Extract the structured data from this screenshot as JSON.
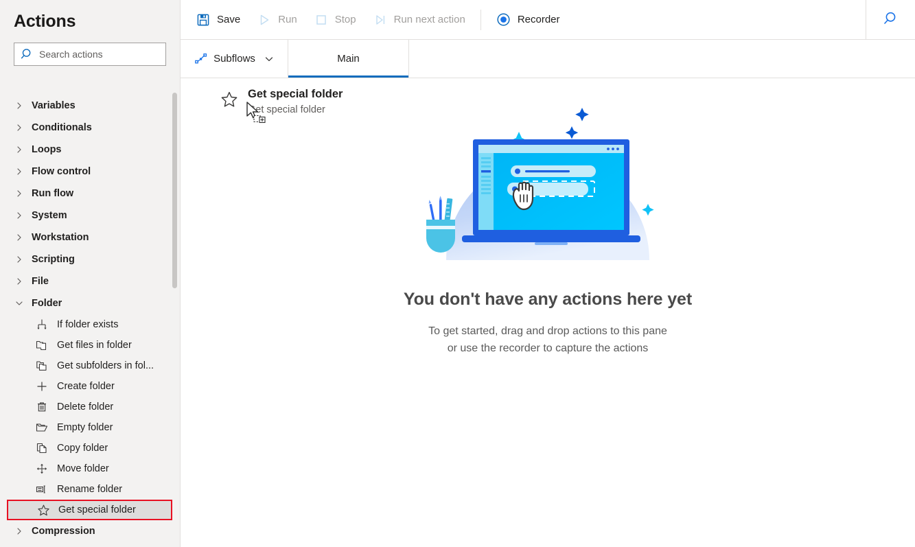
{
  "sidebar": {
    "title": "Actions",
    "search": {
      "placeholder": "Search actions",
      "value": "",
      "icon": "search-icon"
    },
    "groups": [
      {
        "label": "Variables",
        "expanded": false,
        "icon": "chevron-right-icon"
      },
      {
        "label": "Conditionals",
        "expanded": false,
        "icon": "chevron-right-icon"
      },
      {
        "label": "Loops",
        "expanded": false,
        "icon": "chevron-right-icon"
      },
      {
        "label": "Flow control",
        "expanded": false,
        "icon": "chevron-right-icon"
      },
      {
        "label": "Run flow",
        "expanded": false,
        "icon": "chevron-right-icon"
      },
      {
        "label": "System",
        "expanded": false,
        "icon": "chevron-right-icon"
      },
      {
        "label": "Workstation",
        "expanded": false,
        "icon": "chevron-right-icon"
      },
      {
        "label": "Scripting",
        "expanded": false,
        "icon": "chevron-right-icon"
      },
      {
        "label": "File",
        "expanded": false,
        "icon": "chevron-right-icon"
      },
      {
        "label": "Folder",
        "expanded": true,
        "icon": "chevron-down-icon"
      }
    ],
    "folder_items": [
      {
        "label": "If folder exists",
        "icon": "if-folder-exists-icon",
        "selected": false
      },
      {
        "label": "Get files in folder",
        "icon": "get-files-in-folder-icon",
        "selected": false
      },
      {
        "label": "Get subfolders in fol...",
        "icon": "get-subfolders-icon",
        "selected": false
      },
      {
        "label": "Create folder",
        "icon": "plus-icon",
        "selected": false
      },
      {
        "label": "Delete folder",
        "icon": "trash-icon",
        "selected": false
      },
      {
        "label": "Empty folder",
        "icon": "open-folder-icon",
        "selected": false
      },
      {
        "label": "Copy folder",
        "icon": "copy-icon",
        "selected": false
      },
      {
        "label": "Move folder",
        "icon": "move-arrows-icon",
        "selected": false
      },
      {
        "label": "Rename folder",
        "icon": "rename-icon",
        "selected": false
      },
      {
        "label": "Get special folder",
        "icon": "star-icon",
        "selected": true
      }
    ],
    "trailing_groups": [
      {
        "label": "Compression",
        "expanded": false,
        "icon": "chevron-right-icon"
      }
    ],
    "selection_highlight_color": "#e81123",
    "selection_background_color": "#dedddc"
  },
  "toolbar": {
    "save_label": "Save",
    "run_label": "Run",
    "stop_label": "Stop",
    "run_next_label": "Run next action",
    "recorder_label": "Recorder",
    "search_icon": "search-icon",
    "accent_color": "#0f6cbd"
  },
  "tabs": {
    "subflows_label": "Subflows",
    "subflows_icon": "subflow-graph-icon",
    "subflows_chevron": "chevron-down-icon",
    "main_label": "Main",
    "active_tab": "Main"
  },
  "canvas": {
    "drag_ghost": {
      "title": "Get special folder",
      "subtitle": "Get special folder",
      "icon": "star-icon",
      "cursor": "drag-copy-cursor"
    },
    "empty_state": {
      "illustration": "laptop-drag-drop-illustration",
      "title": "You don't have any actions here yet",
      "line1": "To get started, drag and drop actions to this pane",
      "line2": "or use the recorder to capture the actions"
    }
  }
}
